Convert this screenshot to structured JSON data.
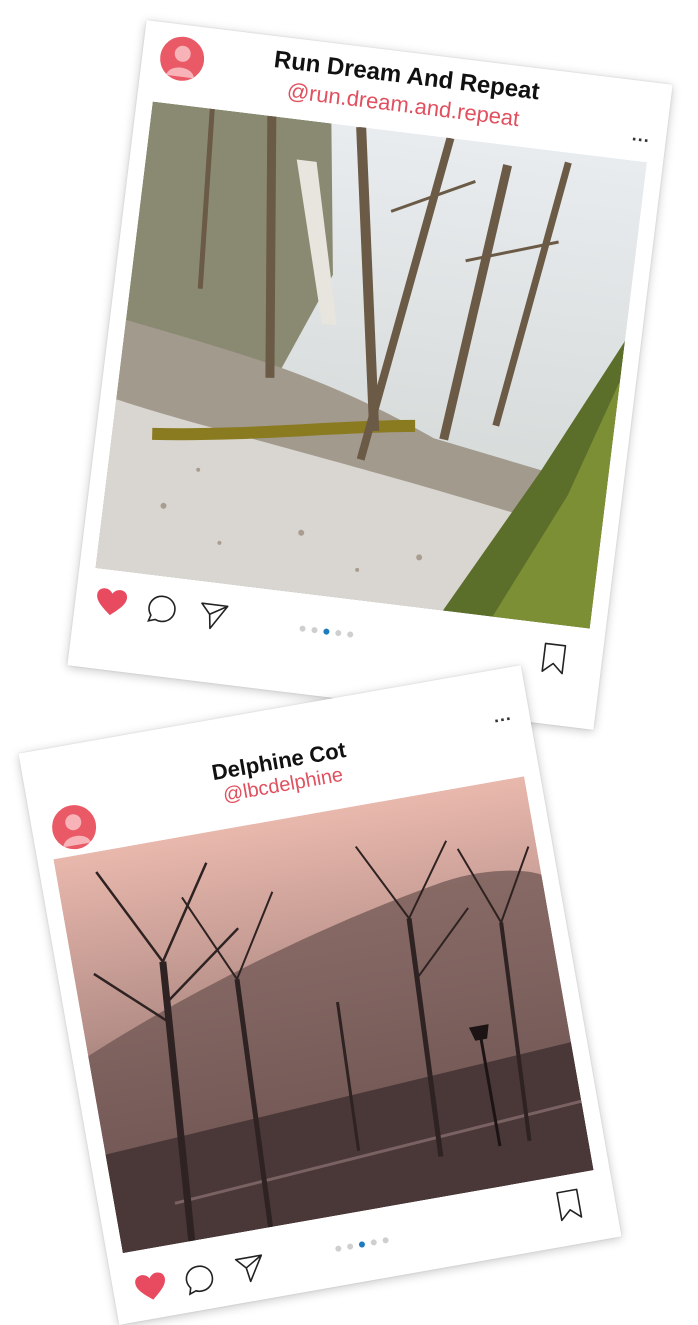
{
  "posts": [
    {
      "display_name": "Run Dream And Repeat",
      "handle": "@run.dream.and.repeat",
      "more_label": "...",
      "liked": true,
      "carousel": {
        "count": 5,
        "active_index": 2
      },
      "photo_subject": "snowy forest path with mossy tree"
    },
    {
      "display_name": "Delphine Cot",
      "handle": "@lbcdelphine",
      "more_label": "...",
      "liked": true,
      "carousel": {
        "count": 5,
        "active_index": 2
      },
      "photo_subject": "foggy park at dusk with bare trees and street lamp"
    }
  ],
  "colors": {
    "heart": "#e84a5f",
    "handle": "#e0505f",
    "avatar": "#ea5a66",
    "dot_active": "#1f7bbf",
    "dot_inactive": "#cfcfcf"
  },
  "icons": [
    "heart-icon",
    "comment-icon",
    "share-icon",
    "bookmark-icon",
    "more-icon",
    "avatar-icon"
  ]
}
